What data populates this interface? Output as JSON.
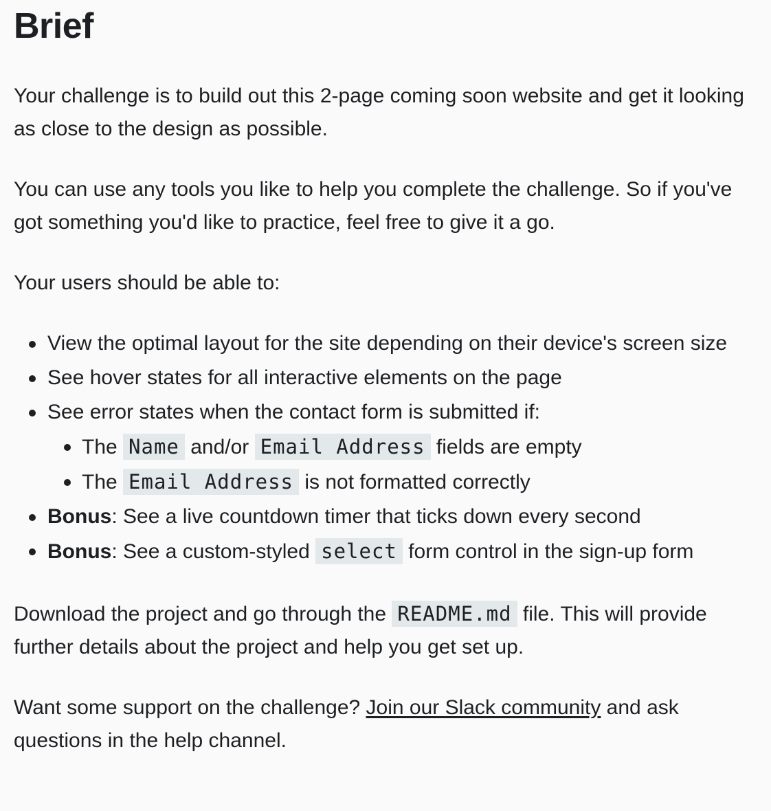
{
  "heading": "Brief",
  "intro": "Your challenge is to build out this 2-page coming soon website and get it looking as close to the design as possible.",
  "tools": "You can use any tools you like to help you complete the challenge. So if you've got something you'd like to practice, feel free to give it a go.",
  "users_intro": "Your users should be able to:",
  "requirements": {
    "item1": "View the optimal layout for the site depending on their device's screen size",
    "item2": "See hover states for all interactive elements on the page",
    "item3": "See error states when the contact form is submitted if:",
    "sub1": {
      "pre": "The ",
      "code_a": "Name",
      "mid": " and/or ",
      "code_b": "Email Address",
      "post": " fields are empty"
    },
    "sub2": {
      "pre": "The ",
      "code": "Email Address",
      "post": " is not formatted correctly"
    },
    "bonus1": {
      "label": "Bonus",
      "text": ": See a live countdown timer that ticks down every second"
    },
    "bonus2": {
      "label": "Bonus",
      "pre": ": See a custom-styled ",
      "code": "select",
      "post": " form control in the sign-up form"
    }
  },
  "download": {
    "pre": "Download the project and go through the ",
    "code": "README.md",
    "post": " file. This will provide further details about the project and help you get set up."
  },
  "support": {
    "pre": "Want some support on the challenge? ",
    "link": "Join our Slack community",
    "post": " and ask questions in the help channel."
  }
}
